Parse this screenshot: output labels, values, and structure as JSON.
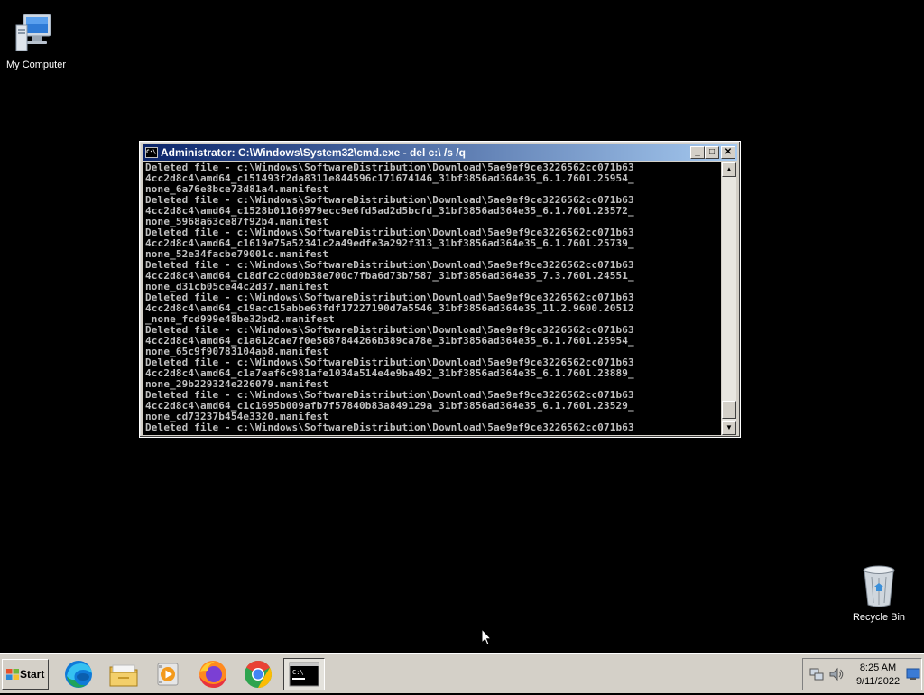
{
  "desktop": {
    "icons": [
      {
        "label": "My Computer"
      },
      {
        "label": "Recycle Bin"
      }
    ]
  },
  "window": {
    "title": "Administrator: C:\\Windows\\System32\\cmd.exe - del  c:\\ /s /q",
    "controls": {
      "minimize": "_",
      "maximize": "□",
      "close": "✕"
    },
    "console_lines": [
      "Deleted file - c:\\Windows\\SoftwareDistribution\\Download\\5ae9ef9ce3226562cc071b63",
      "4cc2d8c4\\amd64_c151493f2da8311e844596c171674146_31bf3856ad364e35_6.1.7601.25954_",
      "none_6a76e8bce73d81a4.manifest",
      "Deleted file - c:\\Windows\\SoftwareDistribution\\Download\\5ae9ef9ce3226562cc071b63",
      "4cc2d8c4\\amd64_c1528b01166979ecc9e6fd5ad2d5bcfd_31bf3856ad364e35_6.1.7601.23572_",
      "none_5968a63ce87f92b4.manifest",
      "Deleted file - c:\\Windows\\SoftwareDistribution\\Download\\5ae9ef9ce3226562cc071b63",
      "4cc2d8c4\\amd64_c1619e75a52341c2a49edfe3a292f313_31bf3856ad364e35_6.1.7601.25739_",
      "none_52e34facbe79001c.manifest",
      "Deleted file - c:\\Windows\\SoftwareDistribution\\Download\\5ae9ef9ce3226562cc071b63",
      "4cc2d8c4\\amd64_c18dfc2c0d0b38e700c7fba6d73b7587_31bf3856ad364e35_7.3.7601.24551_",
      "none_d31cb05ce44c2d37.manifest",
      "Deleted file - c:\\Windows\\SoftwareDistribution\\Download\\5ae9ef9ce3226562cc071b63",
      "4cc2d8c4\\amd64_c19acc15abbe63fdf17227190d7a5546_31bf3856ad364e35_11.2.9600.20512",
      "_none_fcd999e48be32bd2.manifest",
      "Deleted file - c:\\Windows\\SoftwareDistribution\\Download\\5ae9ef9ce3226562cc071b63",
      "4cc2d8c4\\amd64_c1a612cae7f0e5687844266b389ca78e_31bf3856ad364e35_6.1.7601.25954_",
      "none_65c9f90783104ab8.manifest",
      "Deleted file - c:\\Windows\\SoftwareDistribution\\Download\\5ae9ef9ce3226562cc071b63",
      "4cc2d8c4\\amd64_c1a7eaf6c981afe1034a514e4e9ba492_31bf3856ad364e35_6.1.7601.23889_",
      "none_29b229324e226079.manifest",
      "Deleted file - c:\\Windows\\SoftwareDistribution\\Download\\5ae9ef9ce3226562cc071b63",
      "4cc2d8c4\\amd64_c1c1695b009afb7f57840b83a849129a_31bf3856ad364e35_6.1.7601.23529_",
      "none_cd73237b454e3320.manifest",
      "Deleted file - c:\\Windows\\SoftwareDistribution\\Download\\5ae9ef9ce3226562cc071b63"
    ]
  },
  "taskbar": {
    "start_label": "Start",
    "apps": [
      {
        "icon": "edge-icon"
      },
      {
        "icon": "file-explorer-icon"
      },
      {
        "icon": "media-player-icon"
      },
      {
        "icon": "firefox-icon"
      },
      {
        "icon": "chrome-icon"
      },
      {
        "icon": "cmd-icon",
        "active": true
      }
    ],
    "clock": {
      "time": "8:25 AM",
      "date": "9/11/2022"
    }
  },
  "colors": {
    "desktop_bg": "#000000",
    "titlebar_start": "#0a246a",
    "titlebar_end": "#a6caf0",
    "console_text": "#c0c0c0",
    "chrome": "#d4d0c8"
  }
}
